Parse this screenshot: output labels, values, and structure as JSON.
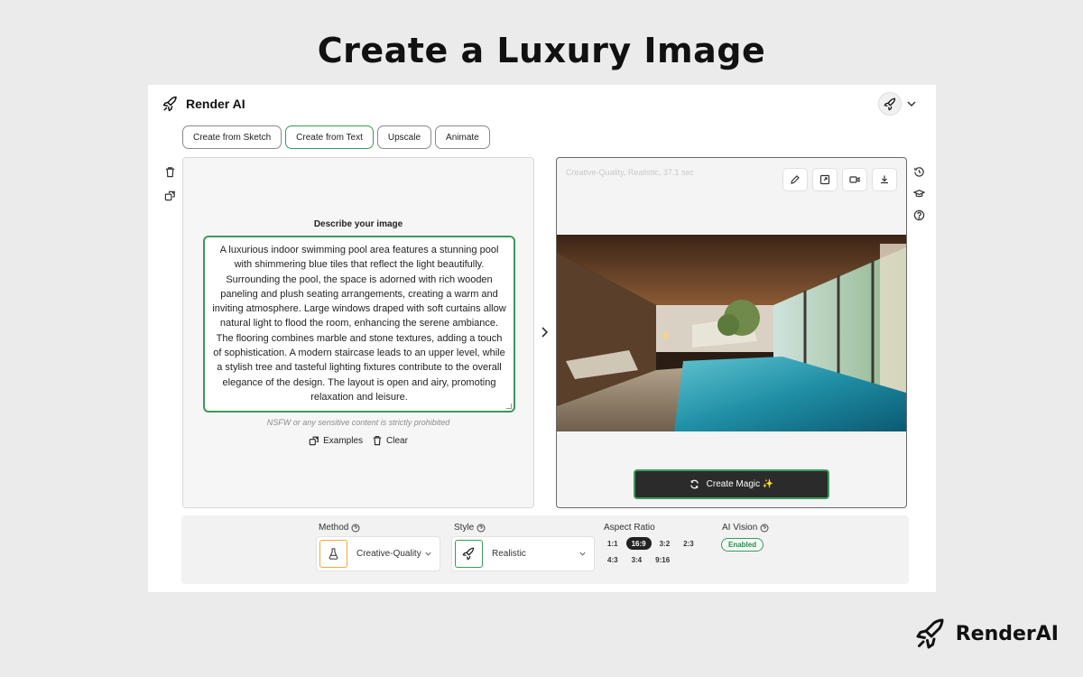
{
  "header": {
    "title": "Create a Luxury Image"
  },
  "app": {
    "brand": "Render AI",
    "tabs": [
      {
        "label": "Create from Sketch",
        "active": false
      },
      {
        "label": "Create from Text",
        "active": true
      },
      {
        "label": "Upscale",
        "active": false
      },
      {
        "label": "Animate",
        "active": false
      }
    ]
  },
  "left_panel": {
    "label": "Describe your image",
    "prompt": "A luxurious indoor swimming pool area features a stunning pool with shimmering blue tiles that reflect the light beautifully. Surrounding the pool, the space is adorned with rich wooden paneling and plush seating arrangements, creating a warm and inviting atmosphere. Large windows draped with soft curtains allow natural light to flood the room, enhancing the serene ambiance. The flooring combines marble and stone textures, adding a touch of sophistication. A modern staircase leads to an upper level, while a stylish tree and tasteful lighting fixtures contribute to the overall elegance of the design. The layout is open and airy, promoting relaxation and leisure.",
    "notice": "NSFW or any sensitive content is strictly prohibited",
    "examples_label": "Examples",
    "clear_label": "Clear"
  },
  "right_panel": {
    "meta": "Creative-Quality, Realistic, 37.1 sec",
    "create_label": "Create Magic ✨"
  },
  "settings": {
    "method_label": "Method",
    "method_value": "Creative-Quality",
    "style_label": "Style",
    "style_value": "Realistic",
    "aspect_label": "Aspect Ratio",
    "aspect_ratios": [
      "1:1",
      "16:9",
      "3:2",
      "2:3",
      "4:3",
      "3:4",
      "9:16"
    ],
    "aspect_selected": "16:9",
    "vision_label": "AI Vision",
    "vision_status": "Enabled"
  },
  "footer": {
    "brand": "RenderAI"
  },
  "colors": {
    "accent": "#3a9a5c",
    "method_border": "#f0a640",
    "dark_button": "#2b2b2b"
  }
}
